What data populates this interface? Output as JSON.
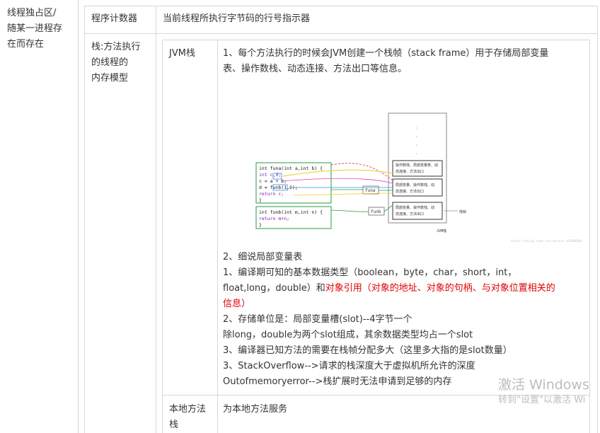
{
  "col1": {
    "lines": [
      "线程独占区/",
      "随某一进程存",
      "在而存在"
    ]
  },
  "pc_row": {
    "label": "程序计数器",
    "desc": "当前线程所执行字节码的行号指示器"
  },
  "stack_row": {
    "label_lines": [
      "栈:方法执行",
      "的线程的",
      "内存模型"
    ]
  },
  "jvm": {
    "label": "JVM栈",
    "para1_line1": "1、每个方法执行的时候会JVM创建一个栈帧（stack frame）用于存储局部变量",
    "para1_line2": "表、操作数栈、动态连接、方法出口等信息。",
    "diagram": {
      "code_a": [
        "int funa(int a,int b) {",
        "    int c,d;",
        "    c = a + b;",
        "    d = funb(1,2);",
        "    return c;",
        "}"
      ],
      "code_b": [
        "int funb(int m,int n) {",
        "    return m+n;",
        "}"
      ],
      "frame_labels": [
        "funa",
        "funb"
      ],
      "box_top_lines": [
        "操作数栈、局部变量表、动",
        "态连接、方法出口"
      ],
      "box_mid_lines": [
        "局部变量、操作数栈、动",
        "态连接、方法出口"
      ],
      "box_bot_lines": [
        "局部变量、操作数栈、动",
        "态连接、方法出口"
      ],
      "side_label": "栈帧",
      "bottom_label": "JVM栈",
      "credit": "https://blog.csdn.net/weixin_43888888"
    },
    "s2_title": "2、细说局部变量表",
    "s2_l1": "1、编译期可知的基本数据类型（boolean，byte，char，short，int，",
    "s2_l2_pre": "float,long，double）和",
    "s2_l2_red": "对象引用（对象的地址、对象的句柄、与对象位置相关的",
    "s2_l3_red": "信息）",
    "s2_l4": "2、存储单位是：局部变量槽(slot)--4字节一个",
    "s2_l5": "除long，double为两个slot组成，其余数据类型均占一个slot",
    "s2_l6": "3、编译器已知方法的需要在栈帧分配多大（这里多大指的是slot数量）",
    "s2_l7": "3、StackOverflow-->请求的栈深度大于虚拟机所允许的深度",
    "s2_l8": "Outofmemoryerror-->栈扩展时无法申请到足够的内存"
  },
  "native": {
    "label_lines": [
      "本地方法",
      "栈"
    ],
    "desc": "为本地方法服务"
  },
  "watermark": {
    "line1": "激活 Windows",
    "line2": "转到\"设置\"以激活 Wi"
  }
}
